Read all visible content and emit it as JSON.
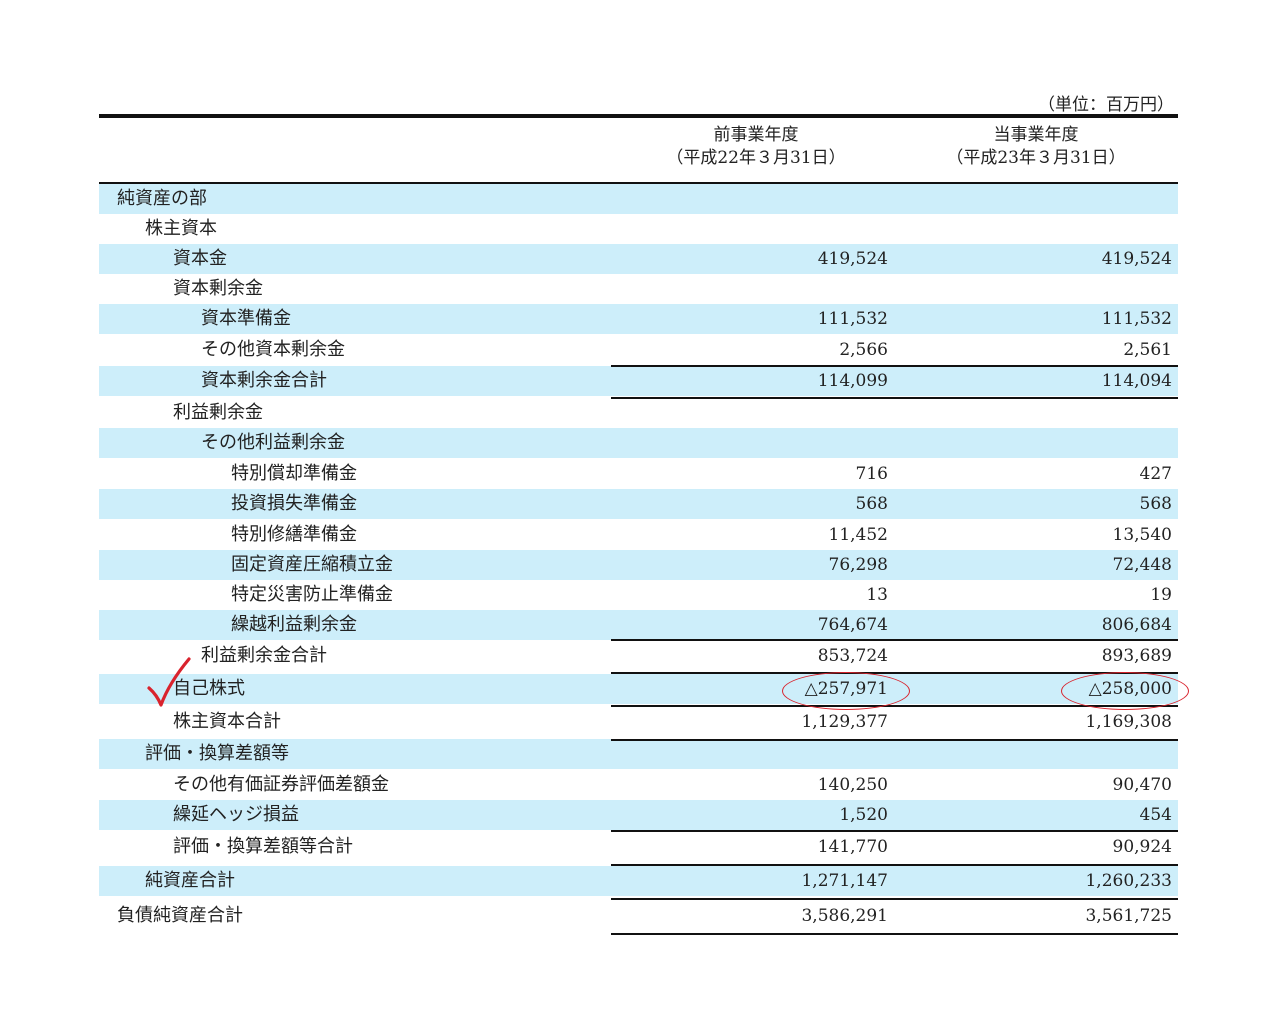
{
  "unit": "（単位：百万円）",
  "headers": {
    "prev": {
      "line1": "前事業年度",
      "line2": "（平成22年３月31日）"
    },
    "curr": {
      "line1": "当事業年度",
      "line2": "（平成23年３月31日）"
    }
  },
  "rows": [
    {
      "label": "純資産の部",
      "indent": 0,
      "shade": true,
      "prev": "",
      "curr": ""
    },
    {
      "label": "株主資本",
      "indent": 1,
      "shade": false,
      "prev": "",
      "curr": ""
    },
    {
      "label": "資本金",
      "indent": 2,
      "shade": true,
      "prev": "419,524",
      "curr": "419,524"
    },
    {
      "label": "資本剰余金",
      "indent": 2,
      "shade": false,
      "prev": "",
      "curr": ""
    },
    {
      "label": "資本準備金",
      "indent": 3,
      "shade": true,
      "prev": "111,532",
      "curr": "111,532"
    },
    {
      "label": "その他資本剰余金",
      "indent": 3,
      "shade": false,
      "prev": "2,566",
      "curr": "2,561"
    },
    {
      "label": "資本剰余金合計",
      "indent": 3,
      "shade": true,
      "prev": "114,099",
      "curr": "114,094"
    },
    {
      "label": "利益剰余金",
      "indent": 2,
      "shade": false,
      "prev": "",
      "curr": ""
    },
    {
      "label": "その他利益剰余金",
      "indent": 3,
      "shade": true,
      "prev": "",
      "curr": ""
    },
    {
      "label": "特別償却準備金",
      "indent": 4,
      "shade": false,
      "prev": "716",
      "curr": "427"
    },
    {
      "label": "投資損失準備金",
      "indent": 4,
      "shade": true,
      "prev": "568",
      "curr": "568"
    },
    {
      "label": "特別修繕準備金",
      "indent": 4,
      "shade": false,
      "prev": "11,452",
      "curr": "13,540"
    },
    {
      "label": "固定資産圧縮積立金",
      "indent": 4,
      "shade": true,
      "prev": "76,298",
      "curr": "72,448"
    },
    {
      "label": "特定災害防止準備金",
      "indent": 4,
      "shade": false,
      "prev": "13",
      "curr": "19"
    },
    {
      "label": "繰越利益剰余金",
      "indent": 4,
      "shade": true,
      "prev": "764,674",
      "curr": "806,684"
    },
    {
      "label": "利益剰余金合計",
      "indent": 3,
      "shade": false,
      "prev": "853,724",
      "curr": "893,689"
    },
    {
      "label": "自己株式",
      "indent": 2,
      "shade": true,
      "prev": "△257,971",
      "curr": "△258,000"
    },
    {
      "label": "株主資本合計",
      "indent": 2,
      "shade": false,
      "prev": "1,129,377",
      "curr": "1,169,308"
    },
    {
      "label": "評価・換算差額等",
      "indent": 1,
      "shade": true,
      "prev": "",
      "curr": ""
    },
    {
      "label": "その他有価証券評価差額金",
      "indent": 2,
      "shade": false,
      "prev": "140,250",
      "curr": "90,470"
    },
    {
      "label": "繰延ヘッジ損益",
      "indent": 2,
      "shade": true,
      "prev": "1,520",
      "curr": "454"
    },
    {
      "label": "評価・換算差額等合計",
      "indent": 2,
      "shade": false,
      "prev": "141,770",
      "curr": "90,924"
    },
    {
      "label": "純資産合計",
      "indent": 1,
      "shade": true,
      "prev": "1,271,147",
      "curr": "1,260,233"
    },
    {
      "label": "負債純資産合計",
      "indent": 0,
      "shade": false,
      "prev": "3,586,291",
      "curr": "3,561,725"
    }
  ],
  "annotation": {
    "mark_color": "#d9232d",
    "mark_icon": "check-icon"
  }
}
